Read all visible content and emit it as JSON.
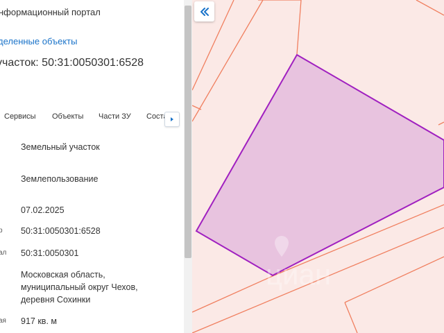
{
  "panel": {
    "portal_title": "нформационный портал",
    "breadcrumb": "деленные объекты",
    "object_title": "участок: 50:31:0050301:6528"
  },
  "tabs": [
    "Сервисы",
    "Объекты",
    "Части ЗУ",
    "Соста"
  ],
  "rows": [
    {
      "label": "",
      "value": "Земельный участок"
    },
    {
      "label": "",
      "value": "Землепользование"
    },
    {
      "label": "",
      "value": "07.02.2025"
    },
    {
      "label": "р",
      "value": "50:31:0050301:6528"
    },
    {
      "label": "ал",
      "value": "50:31:0050301"
    },
    {
      "label": "",
      "value": "Московская область, муниципальный округ Чехов, деревня Сохинки"
    },
    {
      "label": "ая",
      "value": "917 кв. м"
    }
  ],
  "icons": {
    "collapse": "double-chevron-left-icon",
    "tab_scroll": "caret-right-icon",
    "watermark": "cian-location-pin-icon"
  },
  "watermark_text": "циан",
  "colors": {
    "accent": "#1a73c9",
    "map_background": "#fbe9e6",
    "parcel_fill": "#e8c3df",
    "parcel_stroke": "#a020c0",
    "boundary_line": "#f07f5f"
  }
}
